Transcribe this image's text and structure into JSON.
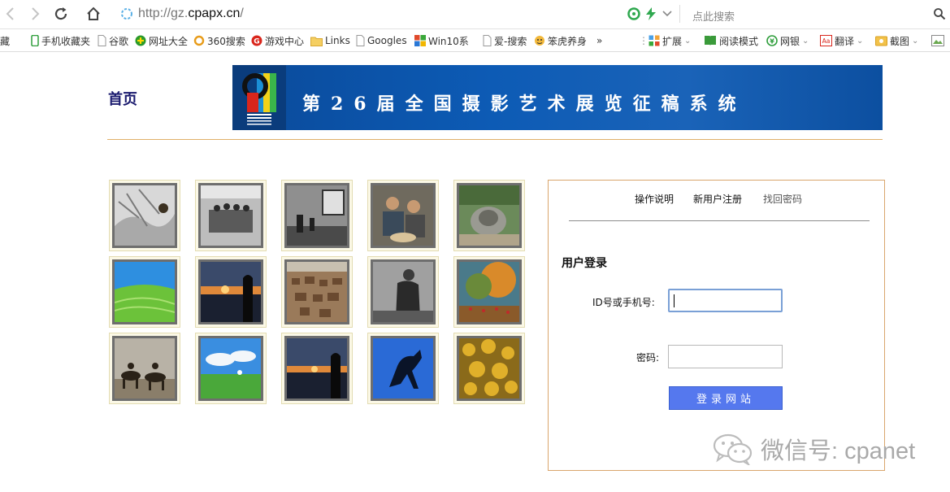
{
  "browser": {
    "url_prefix": "http://gz.",
    "url_domain": "cpapx.cn",
    "url_suffix": "/",
    "search_placeholder": "点此搜索",
    "bookmarks": [
      {
        "label": "藏",
        "icon": "none",
        "color": "#333333"
      },
      {
        "label": "手机收藏夹",
        "icon": "phone-icon",
        "color": "#2f9e3c"
      },
      {
        "label": "谷歌",
        "icon": "page-icon",
        "color": "#888888"
      },
      {
        "label": "网址大全",
        "icon": "plus-circle-icon",
        "color": "#2a9a2a"
      },
      {
        "label": "360搜索",
        "icon": "ring-icon",
        "color": "#e89c1a"
      },
      {
        "label": "游戏中心",
        "icon": "game-icon",
        "color": "#d9261c"
      },
      {
        "label": "Links",
        "icon": "folder-icon",
        "color": "#e8b840"
      },
      {
        "label": "Googles",
        "icon": "page-icon",
        "color": "#888888"
      },
      {
        "label": "Win10系",
        "icon": "windows-icon",
        "color": "#e04a2c"
      },
      {
        "label": "爱-搜索",
        "icon": "page-icon",
        "color": "#888888"
      },
      {
        "label": "笨虎养身",
        "icon": "tiger-icon",
        "color": "#d9a020"
      },
      {
        "label": "»",
        "icon": "none",
        "color": "#666666"
      }
    ],
    "tools": [
      {
        "label": "扩展",
        "icon": "extension-icon",
        "color": "#2f7fd6"
      },
      {
        "label": "阅读模式",
        "icon": "book-icon",
        "color": "#3a9a3a"
      },
      {
        "label": "网银",
        "icon": "bank-icon",
        "color": "#2f9e3c"
      },
      {
        "label": "翻译",
        "icon": "translate-icon",
        "color": "#d9261c"
      },
      {
        "label": "截图",
        "icon": "screenshot-icon",
        "color": "#d9a020"
      }
    ]
  },
  "page": {
    "home_link": "首页",
    "banner_title": "第26届全国摄影艺术展览征稿系统",
    "tabs": {
      "help": "操作说明",
      "register": "新用户注册",
      "find_password": "找回密码"
    },
    "login": {
      "title": "用户登录",
      "id_label": "ID号或手机号:",
      "password_label": "密码:",
      "id_value": "",
      "password_value": "",
      "submit_label": "登录网站"
    },
    "watermark": "微信号: cpanet"
  },
  "colors": {
    "accent_line": "#e0b06a",
    "login_border": "#d9a66d",
    "button_blue": "#5578ee",
    "banner_blue": "#0d5bb5"
  }
}
